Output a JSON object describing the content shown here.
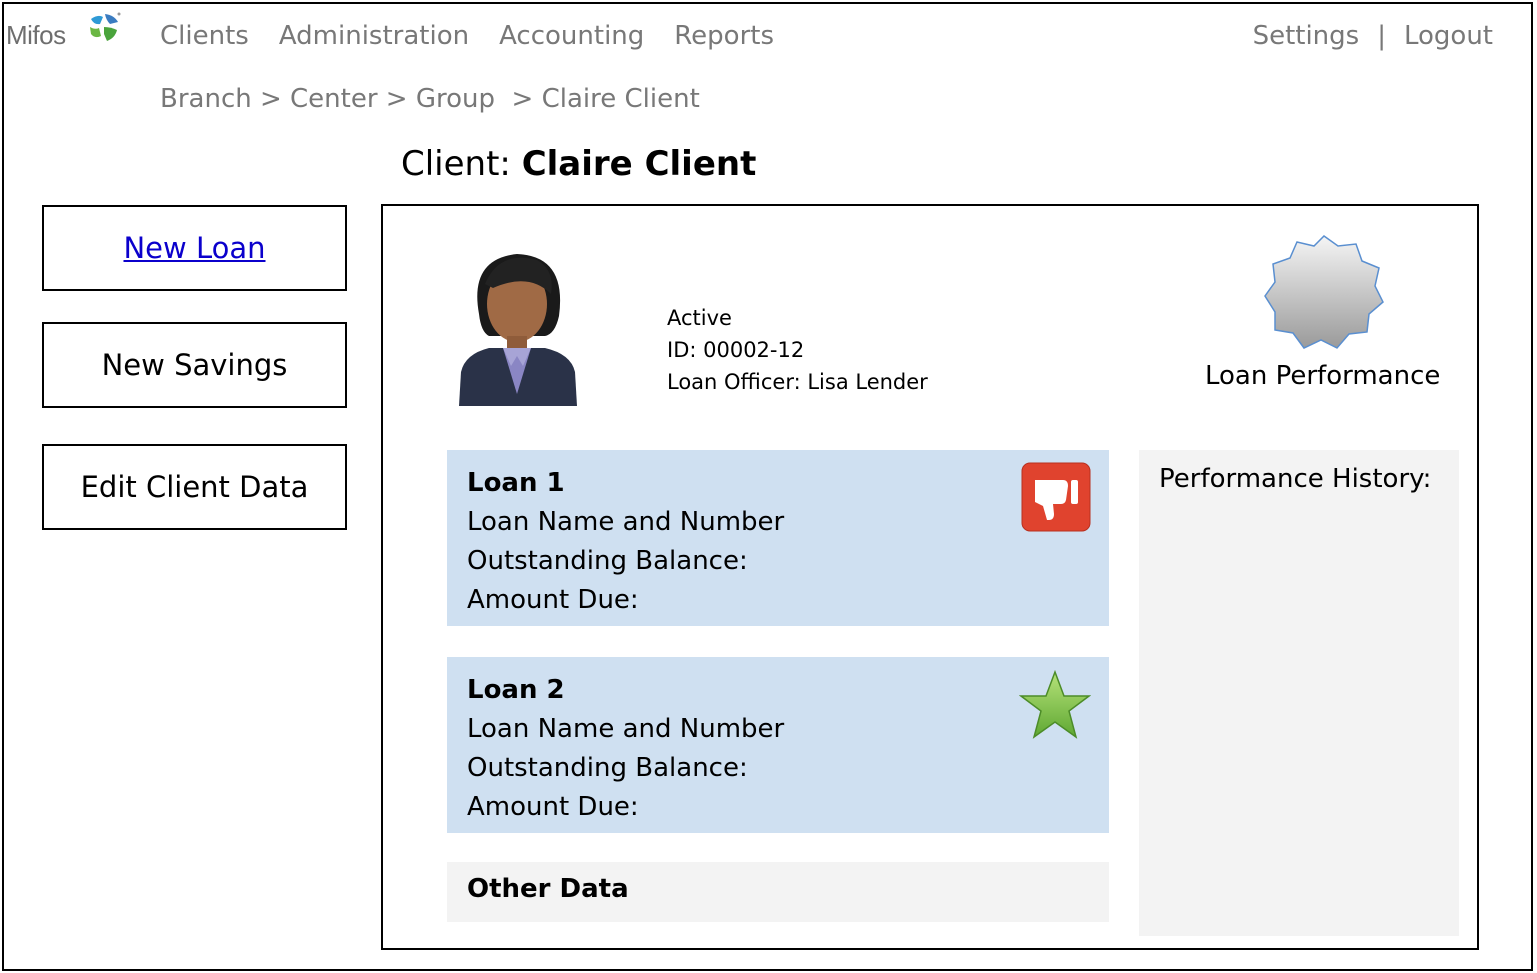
{
  "brand": {
    "name": "Mifos"
  },
  "nav": {
    "items": [
      "Clients",
      "Administration",
      "Accounting",
      "Reports"
    ],
    "settings": "Settings",
    "separator": "|",
    "logout": "Logout"
  },
  "breadcrumb": "Branch > Center > Group  > Claire Client",
  "page": {
    "title_prefix": "Client: ",
    "client_name": "Claire Client"
  },
  "actions": {
    "new_loan": "New Loan",
    "new_savings": "New Savings",
    "edit_client": "Edit Client Data"
  },
  "client": {
    "status": "Active",
    "id": "ID: 00002-12",
    "loan_officer": "Loan Officer: Lisa Lender"
  },
  "performance": {
    "label": "Loan Performance",
    "history_label": "Performance History:"
  },
  "loans": [
    {
      "title": "Loan 1",
      "name": "Loan Name and Number",
      "balance": "Outstanding Balance:",
      "due": "Amount Due:",
      "icon": "thumbs-down-icon"
    },
    {
      "title": "Loan 2",
      "name": "Loan Name and Number",
      "balance": "Outstanding Balance:",
      "due": "Amount Due:",
      "icon": "star-icon"
    }
  ],
  "other_data": "Other Data",
  "colors": {
    "loan_card_bg": "#cfe0f1",
    "panel_bg": "#f3f3f3",
    "link": "#0b00cc",
    "bad": "#e0432e",
    "good": "#7ac143"
  }
}
